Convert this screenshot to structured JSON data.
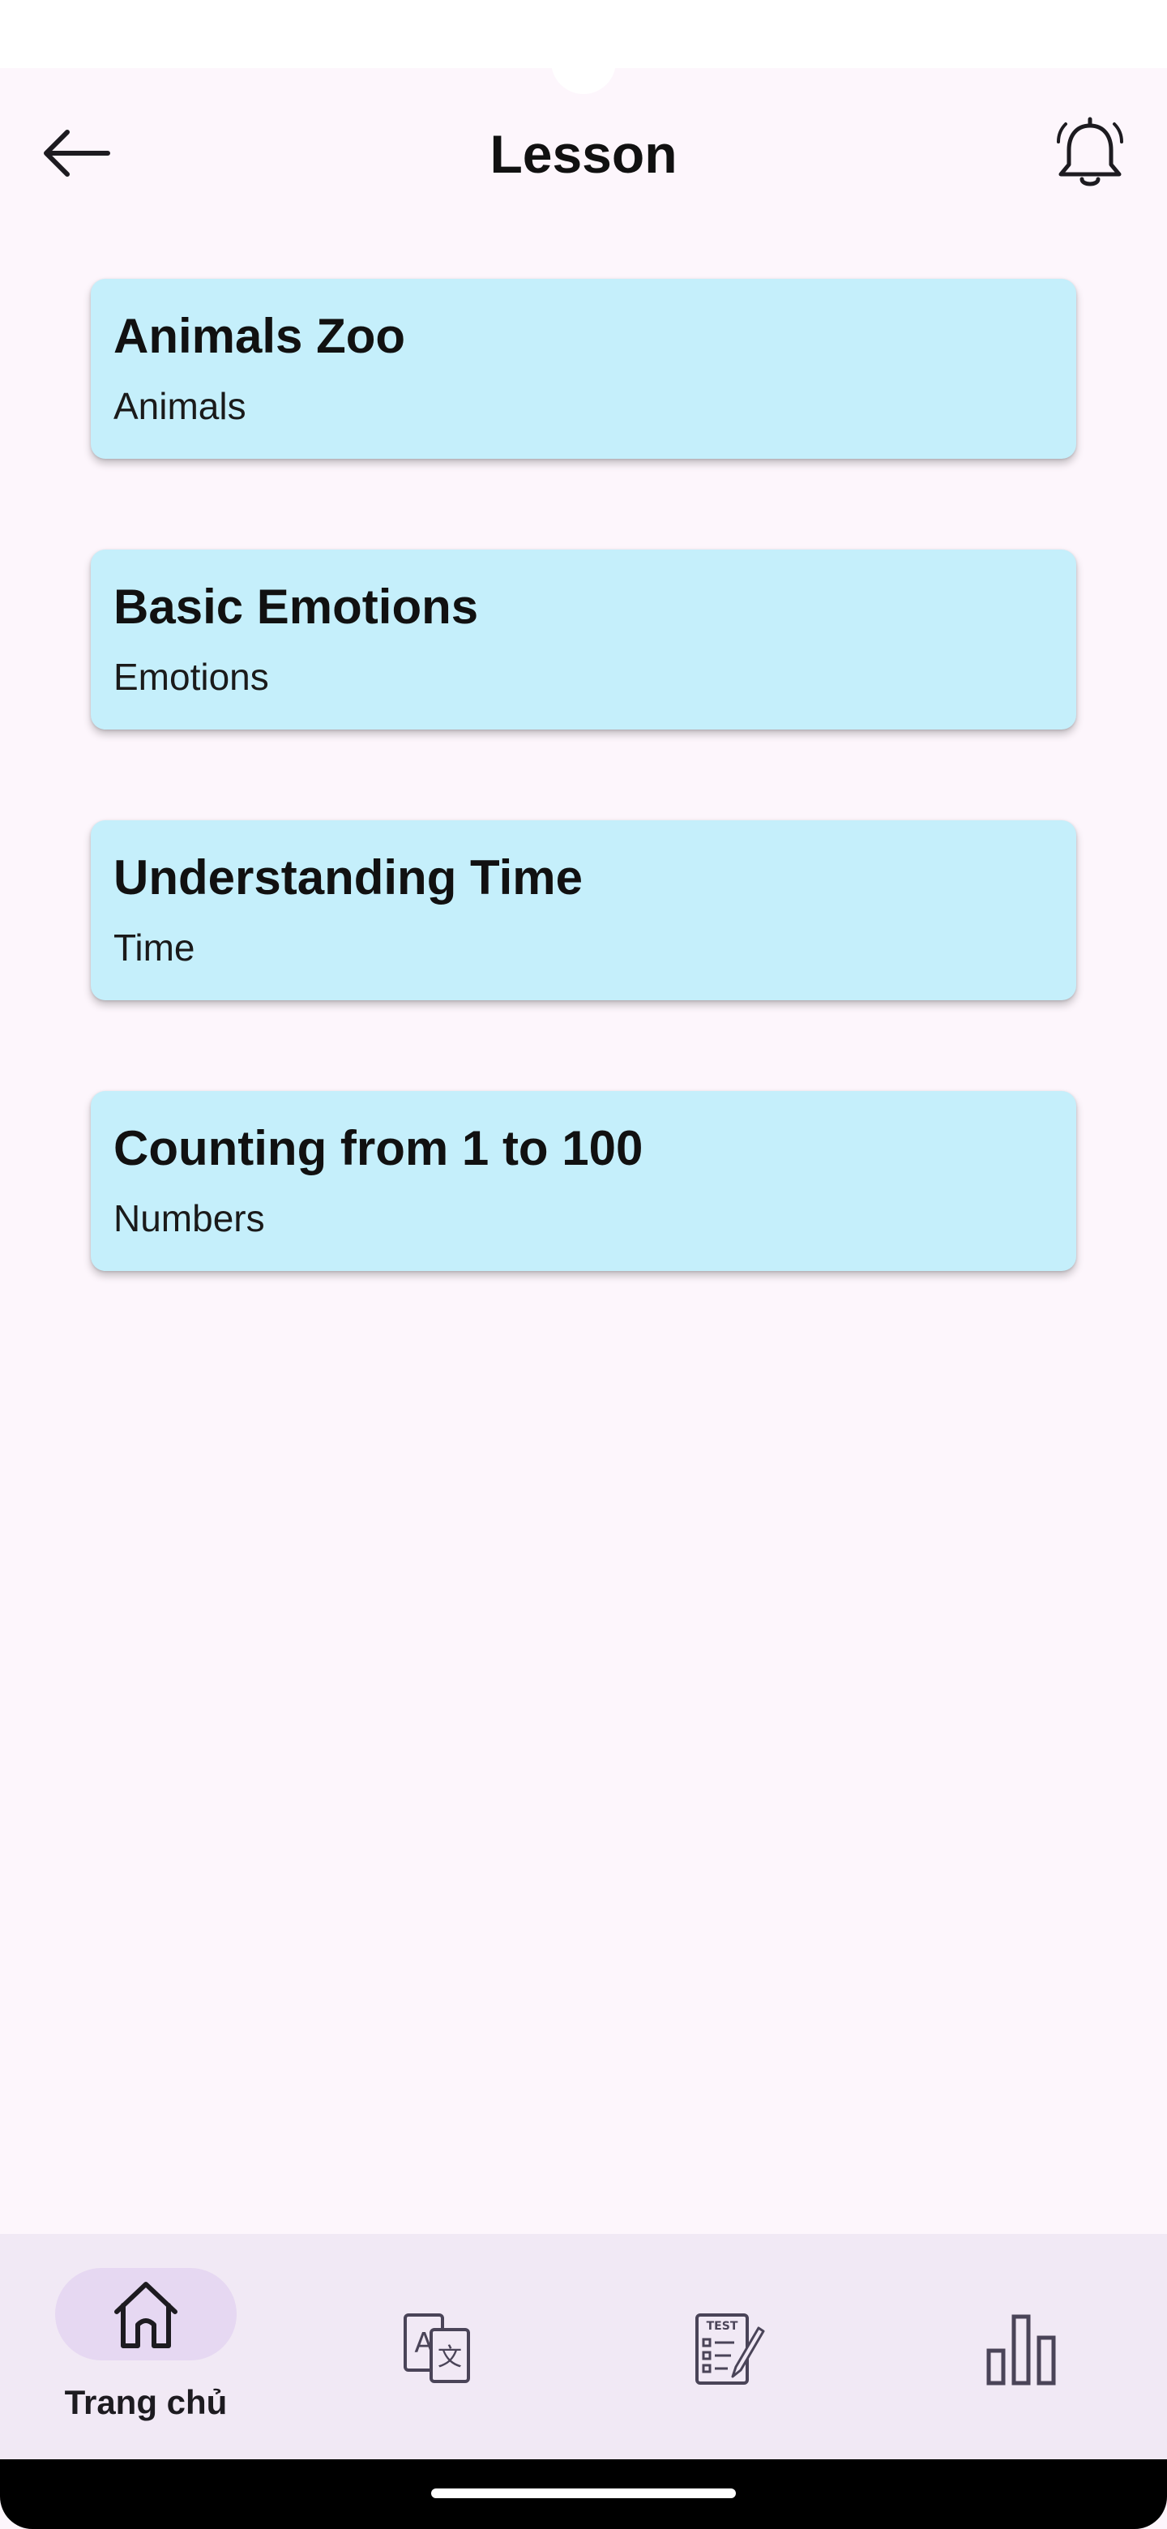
{
  "header": {
    "title": "Lesson",
    "back_icon": "arrow-left-icon",
    "notification_icon": "bell-icon"
  },
  "lessons": [
    {
      "title": "Animals Zoo",
      "category": "Animals"
    },
    {
      "title": "Basic Emotions",
      "category": "Emotions"
    },
    {
      "title": "Understanding Time",
      "category": "Time"
    },
    {
      "title": "Counting from 1 to 100",
      "category": "Numbers"
    }
  ],
  "bottom_nav": {
    "items": [
      {
        "label": "Trang chủ",
        "icon": "home-icon",
        "selected": true
      },
      {
        "label": "",
        "icon": "translate-icon",
        "selected": false
      },
      {
        "label": "",
        "icon": "test-icon",
        "selected": false
      },
      {
        "label": "",
        "icon": "bar-chart-icon",
        "selected": false
      }
    ]
  },
  "colors": {
    "background": "#fdf6fc",
    "card": "#c5effb",
    "nav_background": "#f1e9f5",
    "nav_selected_pill": "#e6d8f2"
  }
}
